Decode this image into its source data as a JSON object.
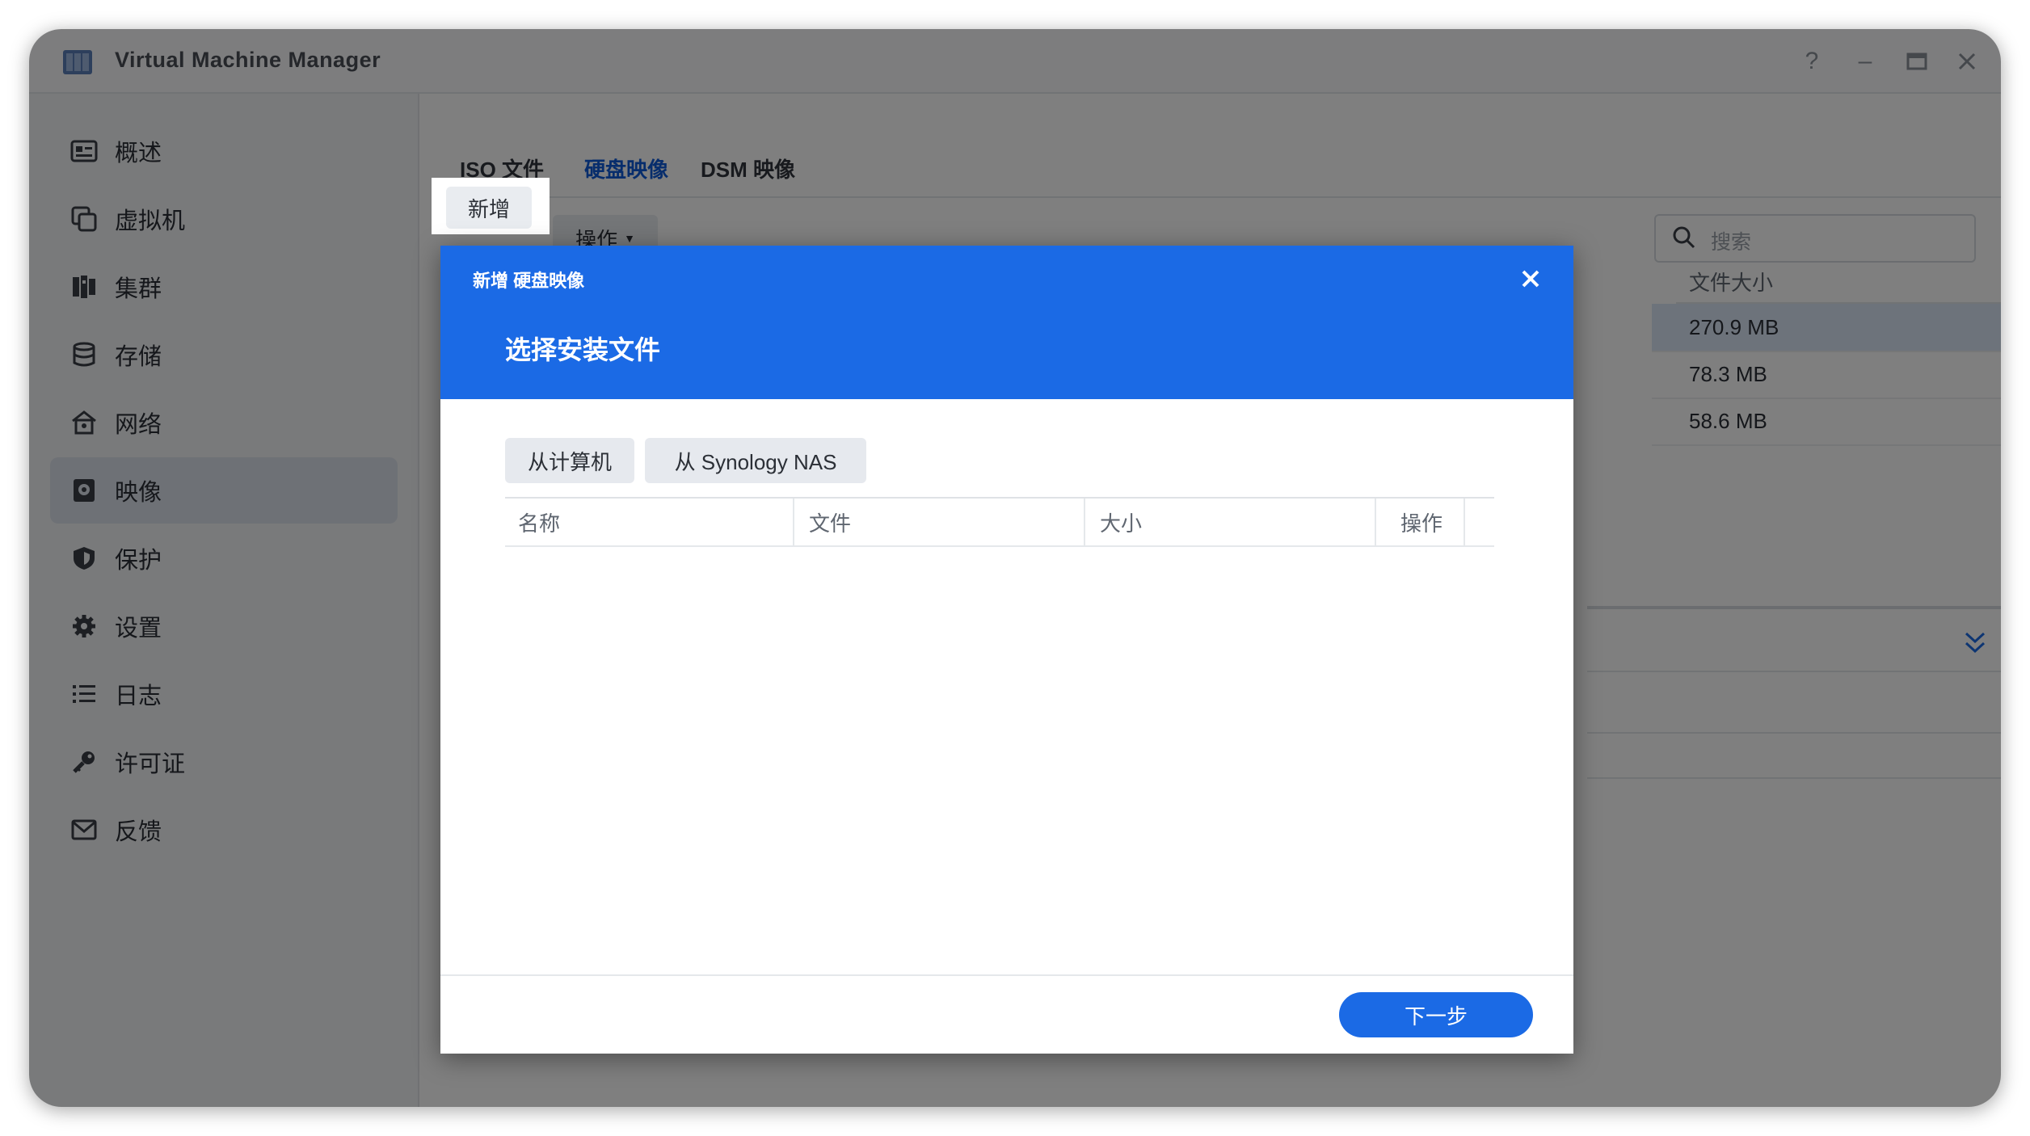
{
  "window": {
    "title": "Virtual Machine Manager"
  },
  "sidebar": {
    "items": [
      {
        "label": "概述",
        "icon": "overview-icon"
      },
      {
        "label": "虚拟机",
        "icon": "virtual-machine-icon"
      },
      {
        "label": "集群",
        "icon": "cluster-icon"
      },
      {
        "label": "存储",
        "icon": "storage-icon"
      },
      {
        "label": "网络",
        "icon": "network-icon"
      },
      {
        "label": "映像",
        "icon": "image-icon",
        "active": true
      },
      {
        "label": "保护",
        "icon": "shield-icon"
      },
      {
        "label": "设置",
        "icon": "gear-icon"
      },
      {
        "label": "日志",
        "icon": "list-icon"
      },
      {
        "label": "许可证",
        "icon": "key-icon"
      },
      {
        "label": "反馈",
        "icon": "mail-icon"
      }
    ]
  },
  "tabs": [
    {
      "label": "ISO 文件"
    },
    {
      "label": "硬盘映像",
      "active": true
    },
    {
      "label": "DSM 映像"
    }
  ],
  "toolbar": {
    "new_label": "新增",
    "action_label": "操作"
  },
  "search": {
    "placeholder": "搜索"
  },
  "table": {
    "column_size": "文件大小",
    "rows": [
      {
        "size": "270.9 MB"
      },
      {
        "size": "78.3 MB"
      },
      {
        "size": "58.6 MB"
      }
    ]
  },
  "dialog": {
    "subtitle": "新增 硬盘映像",
    "title": "选择安装文件",
    "source_buttons": [
      "从计算机",
      "从 Synology NAS"
    ],
    "columns": [
      "名称",
      "文件",
      "大小",
      "操作"
    ],
    "next_label": "下一步"
  },
  "colors": {
    "accent": "#1b6ae5",
    "overlay": "rgba(0,0,0,0.5)"
  }
}
